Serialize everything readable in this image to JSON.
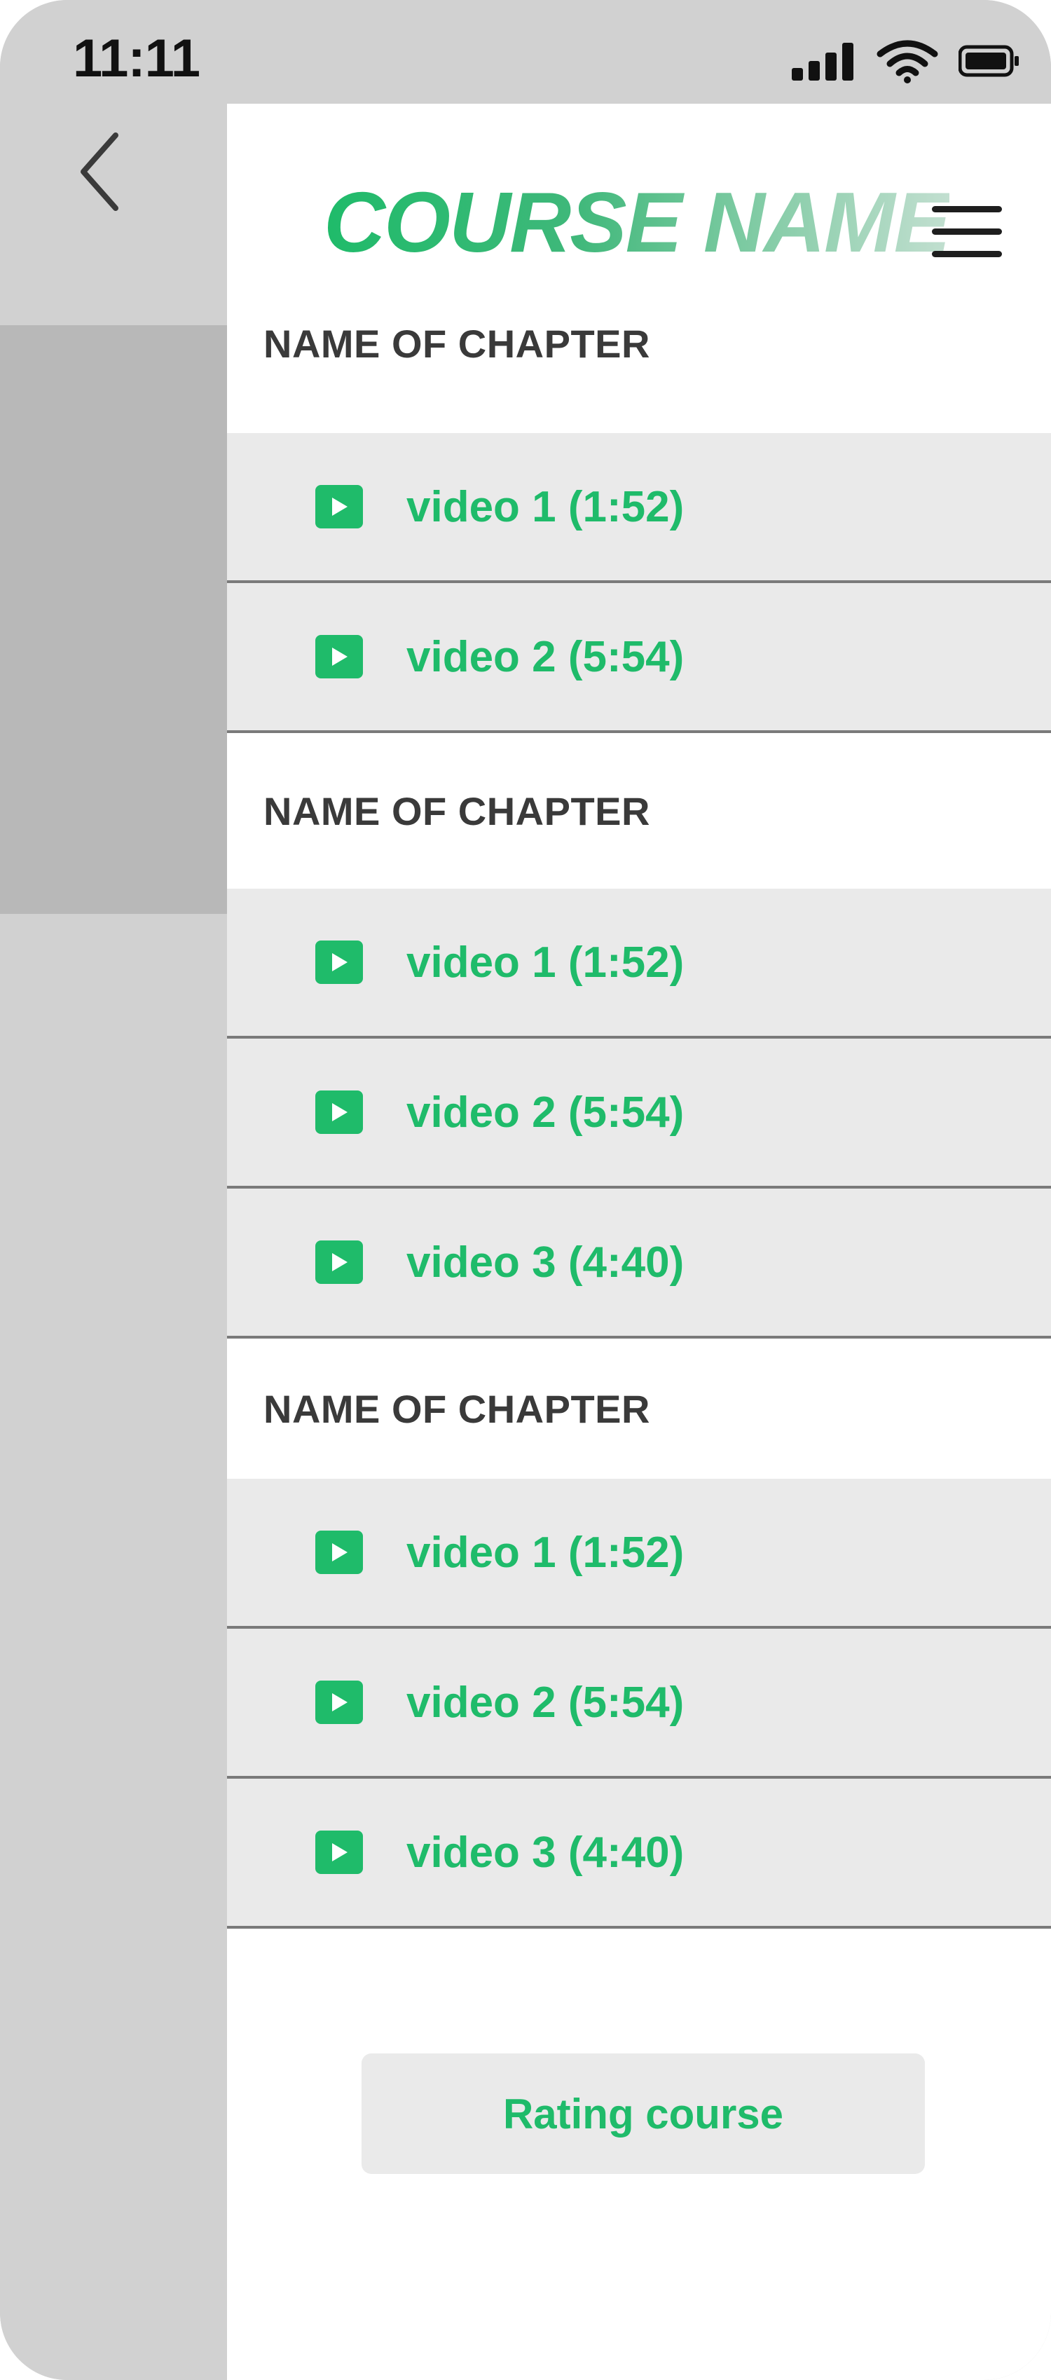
{
  "status_bar": {
    "time": "11:11",
    "icons": [
      "cellular-signal-icon",
      "wifi-icon",
      "battery-icon"
    ]
  },
  "navigation": {
    "back_icon": "chevron-left-icon",
    "menu_icon": "hamburger-menu-icon"
  },
  "header": {
    "title": "COURSE NAME"
  },
  "chapters": [
    {
      "title": "NAME OF CHAPTER",
      "videos": [
        {
          "label": "video 1 (1:52)"
        },
        {
          "label": "video 2 (5:54)"
        }
      ]
    },
    {
      "title": "NAME OF CHAPTER",
      "videos": [
        {
          "label": "video 1 (1:52)"
        },
        {
          "label": "video 2 (5:54)"
        },
        {
          "label": "video 3 (4:40)"
        }
      ]
    },
    {
      "title": "NAME OF CHAPTER",
      "videos": [
        {
          "label": "video 1 (1:52)"
        },
        {
          "label": "video 2 (5:54)"
        },
        {
          "label": "video 3 (4:40)"
        }
      ]
    }
  ],
  "footer": {
    "rating_button_label": "Rating course"
  },
  "colors": {
    "accent": "#1fbb6a",
    "chapter_text": "#3a3a3a",
    "row_background": "#eaeaea",
    "side_background": "#d1d1d1",
    "side_highlight": "#b8b8b8"
  }
}
